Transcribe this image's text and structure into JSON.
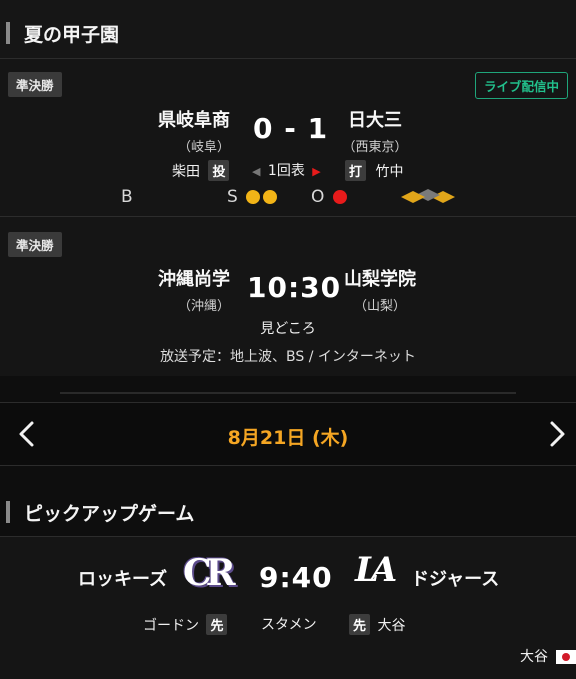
{
  "sections": {
    "koshien_title": "夏の甲子園",
    "pickup_title": "ピックアップゲーム"
  },
  "game1": {
    "round": "準決勝",
    "live": "ライブ配信中",
    "home_team": "県岐阜商",
    "home_region": "（岐阜）",
    "away_team": "日大三",
    "away_region": "（西東京）",
    "score": "0 - 1",
    "pitcher": "柴田",
    "pitcher_tag": "投",
    "inning": "1回表",
    "batter_tag": "打",
    "batter": "竹中",
    "balls_label": "B",
    "strikes_label": "S",
    "outs_label": "O",
    "balls": 0,
    "strikes": 2,
    "outs": 1,
    "colors": {
      "strike": "#f2b417",
      "out": "#e81b1b",
      "runner": "#e0a51a"
    }
  },
  "game2": {
    "round": "準決勝",
    "home_team": "沖縄尚学",
    "home_region": "（沖縄）",
    "away_team": "山梨学院",
    "away_region": "（山梨）",
    "time": "10:30",
    "highlight_link": "見どころ",
    "broadcast": "放送予定：地上波、BS / インターネット"
  },
  "date_nav": {
    "date": "8月21日 (木)",
    "accent": "#f5a623"
  },
  "pickup": {
    "home_team": "ロッキーズ",
    "home_logo_text": "CR",
    "away_logo_text": "LA",
    "away_team": "ドジャース",
    "time": "9:40",
    "home_pitcher": "ゴードン",
    "starter_tag": "先",
    "lineup_link": "スタメン",
    "away_starter_tag": "先",
    "away_pitcher": "大谷",
    "featured_player": "大谷"
  }
}
